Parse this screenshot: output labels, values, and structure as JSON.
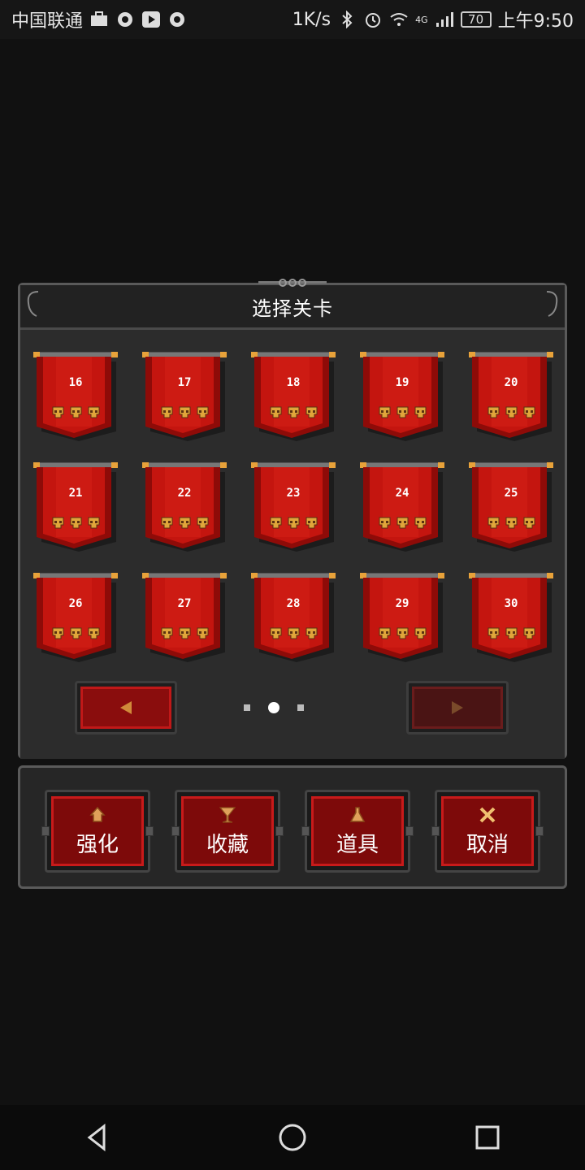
{
  "status_bar": {
    "carrier": "中国联通",
    "speed": "1K/s",
    "network": "4G",
    "battery": "70",
    "time": "上午9:50"
  },
  "dialog": {
    "title": "选择关卡",
    "levels": [
      {
        "number": "16",
        "skulls": 3
      },
      {
        "number": "17",
        "skulls": 3
      },
      {
        "number": "18",
        "skulls": 3
      },
      {
        "number": "19",
        "skulls": 3
      },
      {
        "number": "20",
        "skulls": 3
      },
      {
        "number": "21",
        "skulls": 3
      },
      {
        "number": "22",
        "skulls": 3
      },
      {
        "number": "23",
        "skulls": 3
      },
      {
        "number": "24",
        "skulls": 3
      },
      {
        "number": "25",
        "skulls": 3
      },
      {
        "number": "26",
        "skulls": 3
      },
      {
        "number": "27",
        "skulls": 3
      },
      {
        "number": "28",
        "skulls": 3
      },
      {
        "number": "29",
        "skulls": 3
      },
      {
        "number": "30",
        "skulls": 3
      }
    ],
    "pager": {
      "total_pages": 3,
      "current_page": 2,
      "next_enabled": false
    }
  },
  "toolbar": {
    "buttons": [
      {
        "label": "强化",
        "icon": "upgrade-icon"
      },
      {
        "label": "收藏",
        "icon": "goblet-icon"
      },
      {
        "label": "道具",
        "icon": "potion-icon"
      },
      {
        "label": "取消",
        "icon": "close-icon"
      }
    ]
  },
  "colors": {
    "banner_red": "#c4150f",
    "banner_dark": "#8e0b08",
    "skull_gold": "#e0a53a",
    "button_red": "#7d0a0a"
  }
}
